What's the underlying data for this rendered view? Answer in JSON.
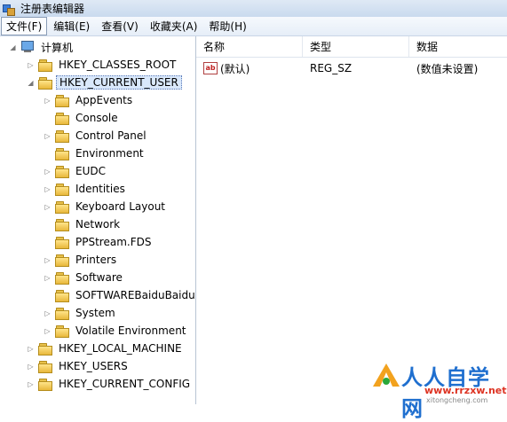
{
  "window": {
    "title": "注册表编辑器"
  },
  "menu": [
    "文件(F)",
    "编辑(E)",
    "查看(V)",
    "收藏夹(A)",
    "帮助(H)"
  ],
  "tree": {
    "root": "计算机",
    "items": [
      "HKEY_CLASSES_ROOT",
      "HKEY_CURRENT_USER",
      "AppEvents",
      "Console",
      "Control Panel",
      "Environment",
      "EUDC",
      "Identities",
      "Keyboard Layout",
      "Network",
      "PPStream.FDS",
      "Printers",
      "Software",
      "SOFTWAREBaiduBaidu",
      "System",
      "Volatile Environment",
      "HKEY_LOCAL_MACHINE",
      "HKEY_USERS",
      "HKEY_CURRENT_CONFIG"
    ]
  },
  "list": {
    "columns": [
      "名称",
      "类型",
      "数据"
    ],
    "rows": [
      {
        "name": "(默认)",
        "type": "REG_SZ",
        "data": "(数值未设置)"
      }
    ]
  },
  "watermark": {
    "brand": "人人自学网",
    "url": "www.rrzxw.net",
    "sub": "xitongcheng.com"
  }
}
